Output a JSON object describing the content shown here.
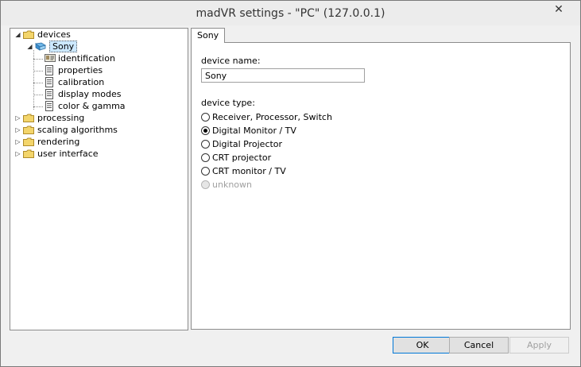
{
  "window": {
    "title": "madVR settings - \"PC\" (127.0.0.1)",
    "close_symbol": "✕"
  },
  "tree": {
    "devices": "devices",
    "sony": "Sony",
    "identification": "identification",
    "properties": "properties",
    "calibration": "calibration",
    "display_modes": "display modes",
    "color_gamma": "color & gamma",
    "processing": "processing",
    "scaling_algorithms": "scaling algorithms",
    "rendering": "rendering",
    "user_interface": "user interface"
  },
  "tab": {
    "label": "Sony"
  },
  "form": {
    "device_name_label": "device name:",
    "device_name_value": "Sony",
    "device_type_label": "device type:",
    "options": [
      {
        "label": "Receiver, Processor, Switch",
        "checked": false,
        "enabled": true
      },
      {
        "label": "Digital Monitor / TV",
        "checked": true,
        "enabled": true
      },
      {
        "label": "Digital Projector",
        "checked": false,
        "enabled": true
      },
      {
        "label": "CRT projector",
        "checked": false,
        "enabled": true
      },
      {
        "label": "CRT monitor / TV",
        "checked": false,
        "enabled": true
      },
      {
        "label": "unknown",
        "checked": false,
        "enabled": false
      }
    ]
  },
  "buttons": {
    "ok": "OK",
    "cancel": "Cancel",
    "apply": "Apply"
  },
  "colors": {
    "selection": "#cce8ff",
    "folder": "#f3d56b",
    "default_button_border": "#0078d7"
  }
}
